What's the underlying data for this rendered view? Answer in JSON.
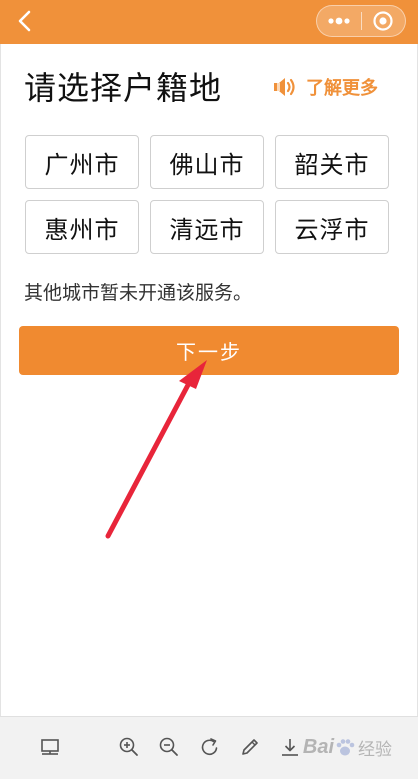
{
  "header": {
    "back_icon": "chevron-left-icon",
    "more_icon": "more-dots-icon",
    "close_icon": "target-circle-icon",
    "bg_color": "#f0913a"
  },
  "main": {
    "title": "请选择户籍地",
    "learn_more": {
      "label": "了解更多",
      "icon": "speaker-icon",
      "color": "#f0913a"
    },
    "cities": [
      "广州市",
      "佛山市",
      "韶关市",
      "惠州市",
      "清远市",
      "云浮市"
    ],
    "notice": "其他城市暂未开通该服务。",
    "next_button": {
      "label": "下一步",
      "color": "#f08a30"
    },
    "annotation": {
      "icon": "red-arrow-icon",
      "color": "#e8253a"
    }
  },
  "toolbar": {
    "icons": [
      "reader-icon",
      "zoom-in-icon",
      "zoom-out-icon",
      "rotate-icon",
      "pen-icon",
      "download-icon"
    ],
    "watermark_text": "Bai",
    "watermark_suffix": "经验"
  }
}
